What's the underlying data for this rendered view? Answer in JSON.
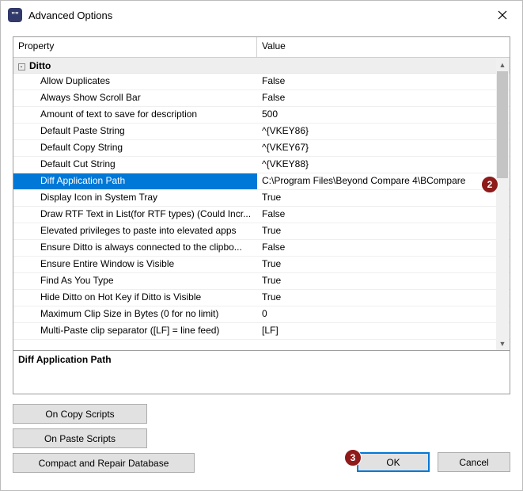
{
  "window": {
    "title": "Advanced Options",
    "icon_glyph": "\"\""
  },
  "grid": {
    "header_property": "Property",
    "header_value": "Value",
    "category": {
      "label": "Ditto",
      "toggle": "-"
    },
    "rows": [
      {
        "name": "Allow Duplicates",
        "value": "False"
      },
      {
        "name": "Always Show Scroll Bar",
        "value": "False"
      },
      {
        "name": "Amount of text to save for description",
        "value": "500"
      },
      {
        "name": "Default Paste String",
        "value": "^{VKEY86}"
      },
      {
        "name": "Default Copy String",
        "value": "^{VKEY67}"
      },
      {
        "name": "Default Cut String",
        "value": "^{VKEY88}"
      },
      {
        "name": "Diff Application Path",
        "value": "C:\\Program Files\\Beyond Compare 4\\BCompare"
      },
      {
        "name": "Display Icon in System Tray",
        "value": "True"
      },
      {
        "name": "Draw RTF Text in List(for RTF types) (Could Incr...",
        "value": "False"
      },
      {
        "name": "Elevated privileges to paste into elevated apps",
        "value": "True"
      },
      {
        "name": "Ensure Ditto is always connected to the clipbo...",
        "value": "False"
      },
      {
        "name": "Ensure Entire Window is Visible",
        "value": "True"
      },
      {
        "name": "Find As You Type",
        "value": "True"
      },
      {
        "name": "Hide Ditto on Hot Key if Ditto is Visible",
        "value": "True"
      },
      {
        "name": "Maximum Clip Size in Bytes (0 for no limit)",
        "value": "0"
      },
      {
        "name": "Multi-Paste clip separator ([LF] = line feed)",
        "value": "[LF]"
      }
    ],
    "selected_index": 6
  },
  "description": {
    "title": "Diff Application Path"
  },
  "buttons": {
    "on_copy": "On Copy Scripts",
    "on_paste": "On Paste Scripts",
    "compact": "Compact and Repair Database",
    "ok": "OK",
    "cancel": "Cancel"
  },
  "annotations": {
    "two": "2",
    "three": "3"
  }
}
